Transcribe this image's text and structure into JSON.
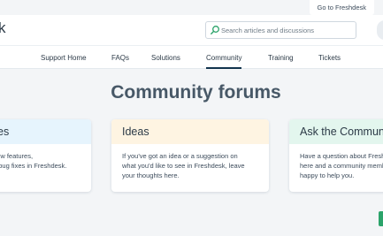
{
  "topbar": {
    "goto_link": "Go to Freshdesk"
  },
  "header": {
    "logo_text": "k",
    "search": {
      "placeholder": "Search articles and discussions"
    }
  },
  "nav": {
    "items": [
      {
        "label": "Support Home"
      },
      {
        "label": "FAQs"
      },
      {
        "label": "Solutions"
      },
      {
        "label": "Community",
        "active": true
      },
      {
        "label": "Training"
      },
      {
        "label": "Tickets"
      }
    ]
  },
  "main": {
    "title": "Community forums",
    "cards": [
      {
        "title": "es",
        "lines": [
          "new features,",
          "d bug fixes in Freshdesk."
        ],
        "header_color": "#e6f4fd"
      },
      {
        "title": "Ideas",
        "lines": [
          "If you've got an idea or a suggestion on",
          "what you'd like to see in Freshdesk, leave",
          "your thoughts here."
        ],
        "header_color": "#fef4e2"
      },
      {
        "title": "Ask the Community",
        "lines": [
          "Have a question about Freshdesk? Post it",
          "here and a community member will be",
          "happy to help you."
        ],
        "header_color": "#e3f6ee"
      }
    ]
  },
  "colors": {
    "accent": "#12344d",
    "search_icon": "#2ba36a",
    "feedback_tab": "#2ba36a"
  }
}
